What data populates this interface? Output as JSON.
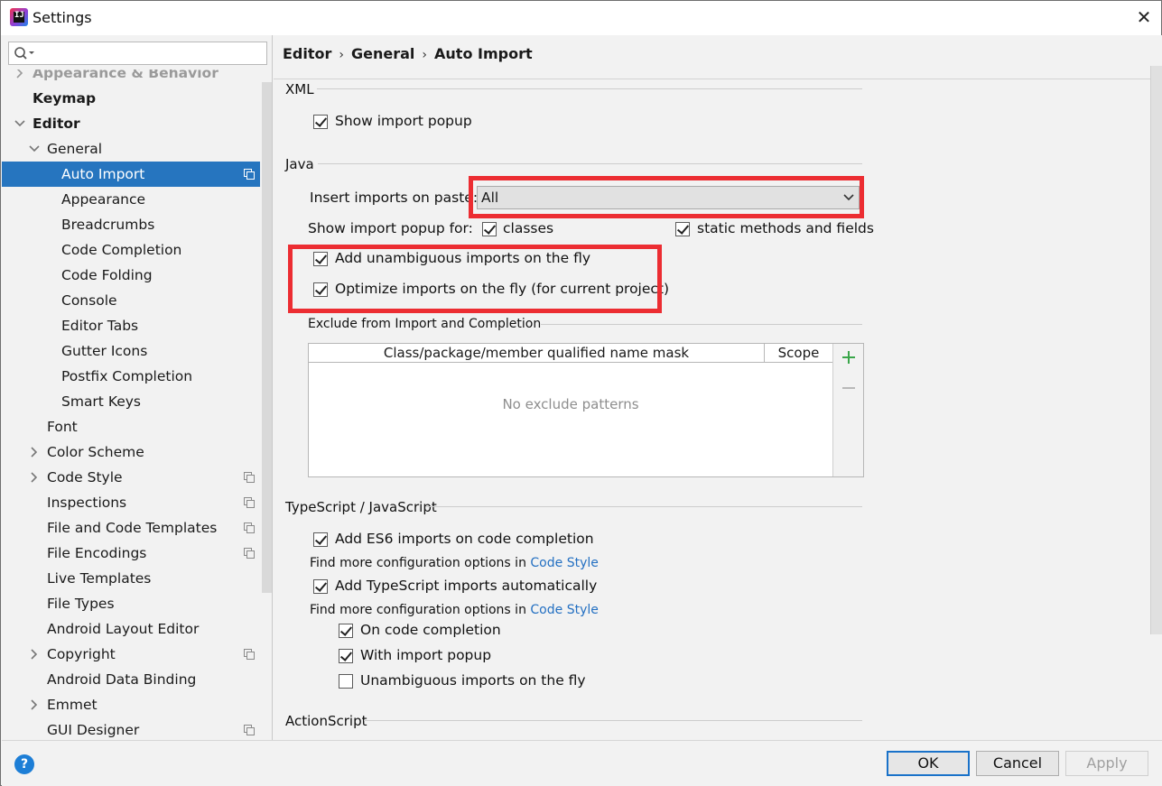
{
  "window": {
    "title": "Settings"
  },
  "search": {
    "placeholder": ""
  },
  "tree": [
    {
      "label": "Appearance & Behavior",
      "indent": 1,
      "chev": "right",
      "bold": true,
      "partial": true,
      "copy": false,
      "selected": false
    },
    {
      "label": "Keymap",
      "indent": 1,
      "chev": "",
      "bold": true,
      "copy": false,
      "selected": false
    },
    {
      "label": "Editor",
      "indent": 1,
      "chev": "down",
      "bold": true,
      "copy": false,
      "selected": false
    },
    {
      "label": "General",
      "indent": 2,
      "chev": "down",
      "bold": false,
      "copy": false,
      "selected": false
    },
    {
      "label": "Auto Import",
      "indent": 3,
      "chev": "",
      "bold": false,
      "copy": true,
      "selected": true
    },
    {
      "label": "Appearance",
      "indent": 3,
      "chev": "",
      "bold": false,
      "copy": false,
      "selected": false
    },
    {
      "label": "Breadcrumbs",
      "indent": 3,
      "chev": "",
      "bold": false,
      "copy": false,
      "selected": false
    },
    {
      "label": "Code Completion",
      "indent": 3,
      "chev": "",
      "bold": false,
      "copy": false,
      "selected": false
    },
    {
      "label": "Code Folding",
      "indent": 3,
      "chev": "",
      "bold": false,
      "copy": false,
      "selected": false
    },
    {
      "label": "Console",
      "indent": 3,
      "chev": "",
      "bold": false,
      "copy": false,
      "selected": false
    },
    {
      "label": "Editor Tabs",
      "indent": 3,
      "chev": "",
      "bold": false,
      "copy": false,
      "selected": false
    },
    {
      "label": "Gutter Icons",
      "indent": 3,
      "chev": "",
      "bold": false,
      "copy": false,
      "selected": false
    },
    {
      "label": "Postfix Completion",
      "indent": 3,
      "chev": "",
      "bold": false,
      "copy": false,
      "selected": false
    },
    {
      "label": "Smart Keys",
      "indent": 3,
      "chev": "",
      "bold": false,
      "copy": false,
      "selected": false
    },
    {
      "label": "Font",
      "indent": 2,
      "chev": "",
      "bold": false,
      "copy": false,
      "selected": false
    },
    {
      "label": "Color Scheme",
      "indent": 2,
      "chev": "right",
      "bold": false,
      "copy": false,
      "selected": false
    },
    {
      "label": "Code Style",
      "indent": 2,
      "chev": "right",
      "bold": false,
      "copy": true,
      "selected": false
    },
    {
      "label": "Inspections",
      "indent": 2,
      "chev": "",
      "bold": false,
      "copy": true,
      "selected": false
    },
    {
      "label": "File and Code Templates",
      "indent": 2,
      "chev": "",
      "bold": false,
      "copy": true,
      "selected": false
    },
    {
      "label": "File Encodings",
      "indent": 2,
      "chev": "",
      "bold": false,
      "copy": true,
      "selected": false
    },
    {
      "label": "Live Templates",
      "indent": 2,
      "chev": "",
      "bold": false,
      "copy": false,
      "selected": false
    },
    {
      "label": "File Types",
      "indent": 2,
      "chev": "",
      "bold": false,
      "copy": false,
      "selected": false
    },
    {
      "label": "Android Layout Editor",
      "indent": 2,
      "chev": "",
      "bold": false,
      "copy": false,
      "selected": false
    },
    {
      "label": "Copyright",
      "indent": 2,
      "chev": "right",
      "bold": false,
      "copy": true,
      "selected": false
    },
    {
      "label": "Android Data Binding",
      "indent": 2,
      "chev": "",
      "bold": false,
      "copy": false,
      "selected": false
    },
    {
      "label": "Emmet",
      "indent": 2,
      "chev": "right",
      "bold": false,
      "copy": false,
      "selected": false
    },
    {
      "label": "GUI Designer",
      "indent": 2,
      "chev": "",
      "bold": false,
      "copy": true,
      "selected": false
    }
  ],
  "breadcrumb": {
    "a": "Editor",
    "b": "General",
    "c": "Auto Import",
    "sep": "›"
  },
  "xml": {
    "title": "XML",
    "show_popup": "Show import popup",
    "show_popup_checked": true
  },
  "java": {
    "title": "Java",
    "insert_label": "Insert imports on paste:",
    "insert_value": "All",
    "popup_for_label": "Show import popup for:",
    "classes": "classes",
    "classes_checked": true,
    "static": "static methods and fields",
    "static_checked": true,
    "unambiguous": "Add unambiguous imports on the fly",
    "unambiguous_checked": true,
    "optimize": "Optimize imports on the fly (for current project)",
    "optimize_checked": true
  },
  "exclude": {
    "title": "Exclude from Import and Completion",
    "col_mask": "Class/package/member qualified name mask",
    "col_scope": "Scope",
    "empty": "No exclude patterns"
  },
  "ts": {
    "title": "TypeScript / JavaScript",
    "es6": "Add ES6 imports on code completion",
    "es6_checked": true,
    "find_more": "Find more configuration options in",
    "code_style": "Code Style",
    "ts_auto": "Add TypeScript imports automatically",
    "ts_auto_checked": true,
    "on_completion": "On code completion",
    "on_completion_checked": true,
    "with_popup": "With import popup",
    "with_popup_checked": true,
    "unambiguous": "Unambiguous imports on the fly",
    "unambiguous_checked": false
  },
  "actionscript": {
    "title": "ActionScript"
  },
  "buttons": {
    "ok": "OK",
    "cancel": "Cancel",
    "apply": "Apply",
    "help": "?"
  },
  "colors": {
    "selection": "#2675bf",
    "highlight": "#ec2d32",
    "link": "#2470c2",
    "add": "#3aa64a"
  }
}
